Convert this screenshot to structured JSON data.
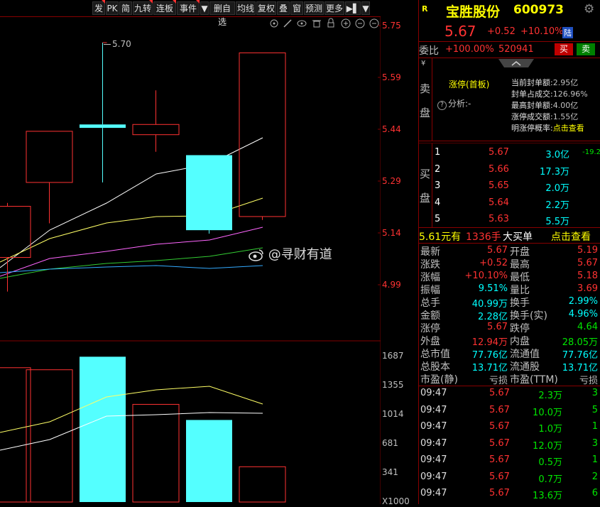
{
  "toolbar": {
    "buttons": [
      "发",
      "PK",
      "简",
      "九转",
      "连板",
      "事件",
      "▼",
      "删自选",
      "均线",
      "复权",
      "叠",
      "窗",
      "预测",
      "更多",
      "▶▌",
      "▼"
    ],
    "icons": [
      "target-icon",
      "pen-icon",
      "eye-icon",
      "delete-icon",
      "lock-icon",
      "zoom-in-icon",
      "zoom-out-icon"
    ]
  },
  "chart": {
    "price_ticks": [
      "5.75",
      "5.59",
      "5.44",
      "5.29",
      "5.14",
      "4.99"
    ],
    "high_annotation": "5.70",
    "volume_ticks": [
      "1687",
      "1355",
      "1014",
      "681",
      "341",
      "X1000"
    ],
    "watermark": "@寻财有道"
  },
  "chart_data": {
    "type": "candlestick",
    "candles": [
      {
        "open": 5.07,
        "close": 5.22,
        "high": 5.23,
        "low": 4.97
      },
      {
        "open": 5.29,
        "close": 5.44,
        "high": 5.44,
        "low": 5.17
      },
      {
        "open": 5.46,
        "close": 5.45,
        "high": 5.7,
        "low": 5.29
      },
      {
        "open": 5.43,
        "close": 5.46,
        "high": 5.56,
        "low": 5.38
      },
      {
        "open": 5.37,
        "close": 5.15,
        "high": 5.37,
        "low": 5.14
      },
      {
        "open": 5.19,
        "close": 5.67,
        "high": 5.67,
        "low": 5.18
      }
    ],
    "volumes": [
      1557,
      1533,
      1684,
      1132,
      951,
      409
    ],
    "ylim": [
      4.99,
      5.75
    ],
    "volume_ylim": [
      0,
      1687
    ]
  },
  "header": {
    "badge": "R",
    "name": "宝胜股份",
    "code": "600973",
    "price": "5.67",
    "change": "+0.52",
    "pct": "+10.10%",
    "tag": "陆"
  },
  "weibi": {
    "label": "委比",
    "ratio": "+100.00%",
    "diff": "520941",
    "buy": "买",
    "sell": "卖"
  },
  "limitup": {
    "title": "涨停(首板)",
    "analysis": "分析:-",
    "rows": [
      {
        "k": "当前封单额:",
        "v": "2.95亿"
      },
      {
        "k": "封单占成交:",
        "v": "126.96%"
      },
      {
        "k": "最高封单额:",
        "v": "4.00亿"
      },
      {
        "k": "涨停成交额:",
        "v": "1.55亿"
      },
      {
        "k": "明涨停概率:",
        "v": "点击查看"
      }
    ]
  },
  "sell_side": {
    "label_top": "卖",
    "label_bottom": "盘",
    "mark": "¥"
  },
  "buy_side": {
    "label_top": "买",
    "label_bottom": "盘",
    "levels": [
      {
        "n": "1",
        "price": "5.67",
        "vol": "3.0亿",
        "extra": "-19.2"
      },
      {
        "n": "2",
        "price": "5.66",
        "vol": "17.3万",
        "extra": ""
      },
      {
        "n": "3",
        "price": "5.65",
        "vol": "2.0万",
        "extra": ""
      },
      {
        "n": "4",
        "price": "5.64",
        "vol": "2.2万",
        "extra": ""
      },
      {
        "n": "5",
        "price": "5.63",
        "vol": "5.5万",
        "extra": ""
      }
    ]
  },
  "bigorder": {
    "price": "5.61元有",
    "vol": "1336手",
    "label": "大买单",
    "link": "点击查看"
  },
  "stats": [
    {
      "k1": "最新",
      "v1": "5.67",
      "c1": "red",
      "k2": "开盘",
      "v2": "5.19",
      "c2": "red"
    },
    {
      "k1": "涨跌",
      "v1": "+0.52",
      "c1": "red",
      "k2": "最高",
      "v2": "5.67",
      "c2": "red"
    },
    {
      "k1": "涨幅",
      "v1": "+10.10%",
      "c1": "red",
      "k2": "最低",
      "v2": "5.18",
      "c2": "red"
    },
    {
      "k1": "振幅",
      "v1": "9.51%",
      "c1": "cyan",
      "k2": "量比",
      "v2": "3.69",
      "c2": "red"
    },
    {
      "k1": "总手",
      "v1": "40.99万",
      "c1": "cyan",
      "k2": "换手",
      "v2": "2.99%",
      "c2": "cyan"
    },
    {
      "k1": "金额",
      "v1": "2.28亿",
      "c1": "cyan",
      "k2": "换手(实)",
      "v2": "4.96%",
      "c2": "cyan"
    },
    {
      "k1": "涨停",
      "v1": "5.67",
      "c1": "red",
      "k2": "跌停",
      "v2": "4.64",
      "c2": "grn"
    },
    {
      "k1": "外盘",
      "v1": "12.94万",
      "c1": "red",
      "k2": "内盘",
      "v2": "28.05万",
      "c2": "grn"
    },
    {
      "k1": "总市值",
      "v1": "77.76亿",
      "c1": "cyan",
      "k2": "流通值",
      "v2": "77.76亿",
      "c2": "cyan"
    },
    {
      "k1": "总股本",
      "v1": "13.71亿",
      "c1": "cyan",
      "k2": "流通股",
      "v2": "13.71亿",
      "c2": "cyan"
    },
    {
      "k1": "市盈(静)",
      "v1": "亏损",
      "c1": "gry",
      "k2": "市盈(TTM)",
      "v2": "亏损",
      "c2": "gry"
    }
  ],
  "ticks": [
    {
      "t": "09:47",
      "p": "5.67",
      "v": "2.3万",
      "n": "3"
    },
    {
      "t": "09:47",
      "p": "5.67",
      "v": "10.0万",
      "n": "5"
    },
    {
      "t": "09:47",
      "p": "5.67",
      "v": "1.0万",
      "n": "1"
    },
    {
      "t": "09:47",
      "p": "5.67",
      "v": "12.0万",
      "n": "3"
    },
    {
      "t": "09:47",
      "p": "5.67",
      "v": "0.5万",
      "n": "1"
    },
    {
      "t": "09:47",
      "p": "5.67",
      "v": "0.7万",
      "n": "2"
    },
    {
      "t": "09:47",
      "p": "5.67",
      "v": "13.6万",
      "n": "6"
    }
  ],
  "colors": {
    "up": "#ff3232",
    "down": "#54ffff",
    "bg": "#000000",
    "grid": "#800000"
  }
}
